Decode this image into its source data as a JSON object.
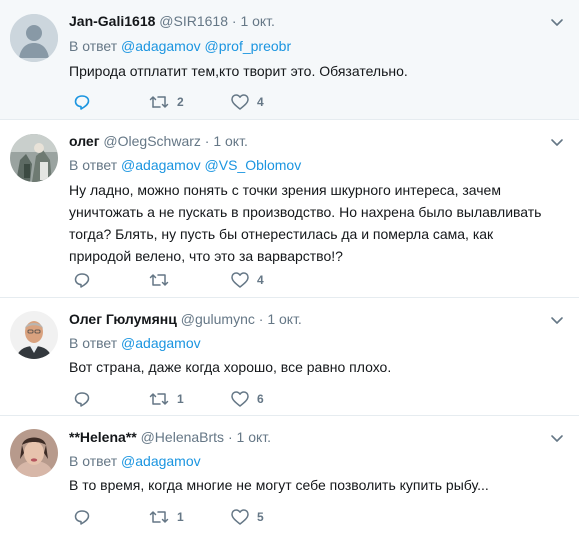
{
  "tweets": [
    {
      "name": "Jan-Gali1618",
      "handle": "@SIR1618",
      "dot": "·",
      "time": "1 окт.",
      "reply_prefix": "В ответ",
      "mentions": [
        "@adagamov",
        "@prof_preobr"
      ],
      "text": "Природа отплатит тем,кто творит это. Обязательно.",
      "retweets": "2",
      "likes": "4"
    },
    {
      "name": "олег",
      "handle": "@OlegSchwarz",
      "dot": "·",
      "time": "1 окт.",
      "reply_prefix": "В ответ",
      "mentions": [
        "@adagamov",
        "@VS_Oblomov"
      ],
      "text": "Ну ладно, можно понять с точки зрения шкурного интереса, зачем уничтожать а не пускать в производство. Но нахрена было вылавливать тогда? Блять, ну пусть бы отнерестилась да и померла сама, как природой велено, что это за варварство!?",
      "retweets": "",
      "likes": "4"
    },
    {
      "name": "Олег Гюлумянц",
      "handle": "@gulumync",
      "dot": "·",
      "time": "1 окт.",
      "reply_prefix": "В ответ",
      "mentions": [
        "@adagamov"
      ],
      "text": "Вот страна, даже когда хорошо, все равно плохо.",
      "retweets": "1",
      "likes": "6"
    },
    {
      "name": "**Helena**",
      "handle": "@HelenaBrts",
      "dot": "·",
      "time": "1 окт.",
      "reply_prefix": "В ответ",
      "mentions": [
        "@adagamov"
      ],
      "text": "В то время, когда многие не могут себе позволить купить рыбу...",
      "retweets": "1",
      "likes": "5"
    }
  ],
  "colors": {
    "link": "#1b95e0",
    "muted": "#657786",
    "text": "#14171a",
    "highlight_bg": "#f5f8fa",
    "border": "#e6ecf0"
  },
  "icons": {
    "reply": "reply-icon",
    "retweet": "retweet-icon",
    "like": "heart-icon",
    "more": "chevron-down-icon"
  }
}
